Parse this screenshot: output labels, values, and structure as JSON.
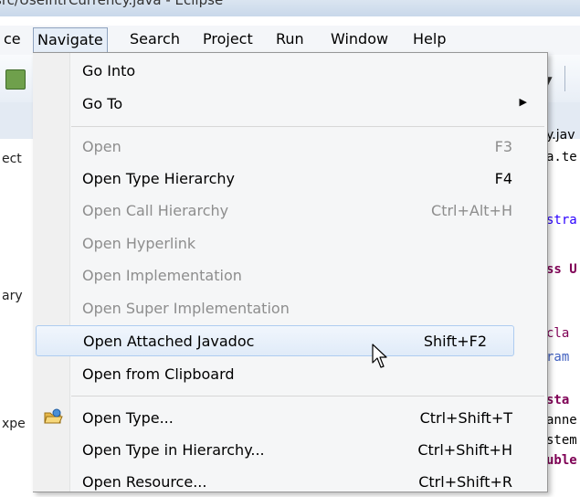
{
  "window": {
    "title": "src/UseIntrCurrency.java - Eclipse"
  },
  "menubar": {
    "items": [
      {
        "label": "ce"
      },
      {
        "label": "Navigate",
        "active": true
      },
      {
        "label": "Search"
      },
      {
        "label": "Project"
      },
      {
        "label": "Run"
      },
      {
        "label": "Window"
      },
      {
        "label": "Help"
      }
    ]
  },
  "left_panel": {
    "fragments": [
      "ect",
      "ary",
      "xpe"
    ]
  },
  "editor": {
    "fragments": [
      "y.jav",
      "a.te",
      "stra",
      "ss U",
      "cla",
      "ram",
      "sta",
      "anne",
      "stem",
      "uble"
    ]
  },
  "navigate_menu": {
    "items": [
      {
        "label": "Go Into",
        "shortcut": "",
        "enabled": true
      },
      {
        "label": "Go To",
        "shortcut": "",
        "enabled": true,
        "submenu": true
      },
      {
        "label": "Open",
        "shortcut": "F3",
        "enabled": false
      },
      {
        "label": "Open Type Hierarchy",
        "shortcut": "F4",
        "enabled": true
      },
      {
        "label": "Open Call Hierarchy",
        "shortcut": "Ctrl+Alt+H",
        "enabled": false
      },
      {
        "label": "Open Hyperlink",
        "shortcut": "",
        "enabled": false
      },
      {
        "label": "Open Implementation",
        "shortcut": "",
        "enabled": false
      },
      {
        "label": "Open Super Implementation",
        "shortcut": "",
        "enabled": false
      },
      {
        "label": "Open Attached Javadoc",
        "shortcut": "Shift+F2",
        "enabled": true,
        "hovered": true
      },
      {
        "label": "Open from Clipboard",
        "shortcut": "",
        "enabled": true
      },
      {
        "label": "Open Type...",
        "shortcut": "Ctrl+Shift+T",
        "enabled": true,
        "icon": "open-type-icon"
      },
      {
        "label": "Open Type in Hierarchy...",
        "shortcut": "Ctrl+Shift+H",
        "enabled": true
      },
      {
        "label": "Open Resource...",
        "shortcut": "Ctrl+Shift+R",
        "enabled": true
      }
    ]
  },
  "colors": {
    "hover_border": "#aeccf0",
    "disabled_text": "#8d8d8d",
    "keyword": "#7f0055"
  }
}
